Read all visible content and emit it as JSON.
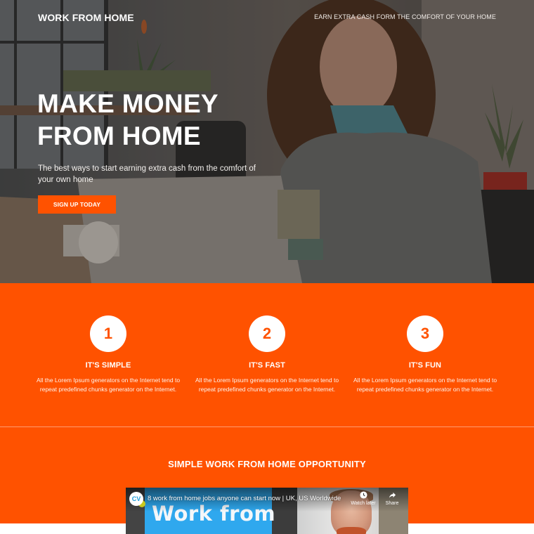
{
  "header": {
    "brand": "WORK FROM HOME",
    "tagline": "EARN EXTRA CASH FORM THE COMFORT OF YOUR HOME"
  },
  "hero": {
    "title_line1": "MAKE MONEY",
    "title_line2": "FROM HOME",
    "subtitle": "The best ways to start earning extra cash from the comfort of your own home",
    "cta_label": "SIGN UP TODAY"
  },
  "features": [
    {
      "number": "1",
      "title": "IT'S SIMPLE",
      "description": "All the Lorem Ipsum generators on the Internet tend to repeat predefined chunks generator on the Internet."
    },
    {
      "number": "2",
      "title": "IT'S FAST",
      "description": "All the Lorem Ipsum generators on the Internet tend to repeat predefined chunks generator on the Internet."
    },
    {
      "number": "3",
      "title": "IT'S FUN",
      "description": "All the Lorem Ipsum generators on the Internet tend to repeat predefined chunks generator on the Internet."
    }
  ],
  "opportunity": {
    "title": "SIMPLE WORK FROM HOME OPPORTUNITY"
  },
  "video": {
    "channel_logo": "CV",
    "title": "8 work from home jobs anyone can start now | UK, US Worldwide",
    "thumbnail_text": "Work from",
    "watch_later_label": "Watch later",
    "share_label": "Share"
  },
  "colors": {
    "accent": "#ff5200",
    "divider": "#ff9a70",
    "video_blue": "#2fa8ee"
  }
}
